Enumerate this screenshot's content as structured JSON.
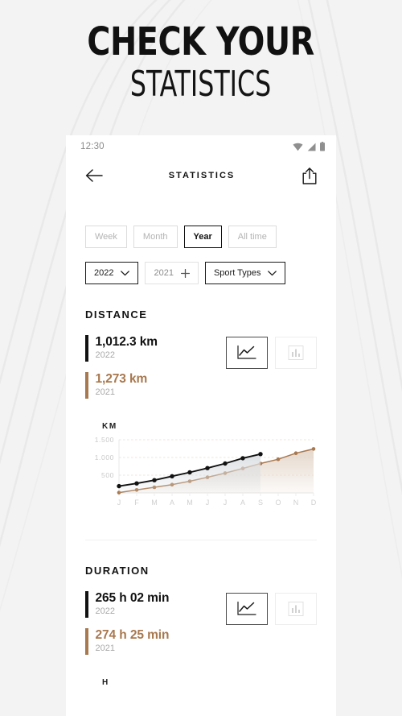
{
  "promo": {
    "line1": "CHECK YOUR",
    "line2": "STATISTICS"
  },
  "phone": {
    "status": {
      "time": "12:30",
      "icons": [
        "wifi-icon",
        "signal-icon",
        "battery-icon"
      ]
    },
    "nav": {
      "back_icon": "arrow-left-icon",
      "title": "STATISTICS",
      "share_icon": "share-icon"
    },
    "range_chips": [
      {
        "label": "Week",
        "active": false
      },
      {
        "label": "Month",
        "active": false
      },
      {
        "label": "Year",
        "active": true
      },
      {
        "label": "All time",
        "active": false
      }
    ],
    "selectors": [
      {
        "label": "2022",
        "icon": "chevron-down-icon",
        "style": "dark"
      },
      {
        "label": "2021",
        "icon": "plus-icon",
        "style": "light"
      },
      {
        "label": "Sport Types",
        "icon": "chevron-down-icon",
        "style": "dark"
      }
    ],
    "sections": [
      {
        "title": "DISTANCE",
        "stats": [
          {
            "value": "1,012.3 km",
            "year": "2022",
            "color": "#111111"
          },
          {
            "value": "1,273 km",
            "year": "2021",
            "color": "#a8784e"
          }
        ],
        "toggles": [
          {
            "icon": "line-chart-icon",
            "active": true
          },
          {
            "icon": "bar-chart-icon",
            "active": false
          }
        ],
        "unit": "KM"
      },
      {
        "title": "DURATION",
        "stats": [
          {
            "value": "265 h 02 min",
            "year": "2022",
            "color": "#111111"
          },
          {
            "value": "274 h 25 min",
            "year": "2021",
            "color": "#a8784e"
          }
        ],
        "toggles": [
          {
            "icon": "line-chart-icon",
            "active": true
          },
          {
            "icon": "bar-chart-icon",
            "active": false
          }
        ],
        "unit": "H"
      }
    ]
  },
  "colors": {
    "current_year": "#111111",
    "previous_year": "#a8784e",
    "muted": "#b3b3b3",
    "page_bg": "#f2f2f2"
  },
  "chart_data": {
    "type": "line",
    "title": "",
    "xlabel": "",
    "ylabel": "KM",
    "ylim": [
      0,
      1500
    ],
    "yticks": [
      500,
      1000,
      1500
    ],
    "ytick_labels": [
      "500",
      "1.000",
      "1.500"
    ],
    "grid": true,
    "legend": "none",
    "categories": [
      "J",
      "F",
      "M",
      "A",
      "M",
      "J",
      "J",
      "A",
      "S",
      "O",
      "N",
      "D"
    ],
    "series": [
      {
        "name": "2022",
        "color": "#111111",
        "values": [
          190,
          268,
          360,
          470,
          580,
          700,
          830,
          980,
          1095,
          null,
          null,
          null
        ],
        "area_fill": "#dcdfe2"
      },
      {
        "name": "2021",
        "color": "#a8784e",
        "values": [
          10,
          85,
          160,
          235,
          330,
          440,
          560,
          690,
          830,
          950,
          1120,
          1240
        ],
        "area_fill": "#e3d5c8"
      }
    ]
  }
}
